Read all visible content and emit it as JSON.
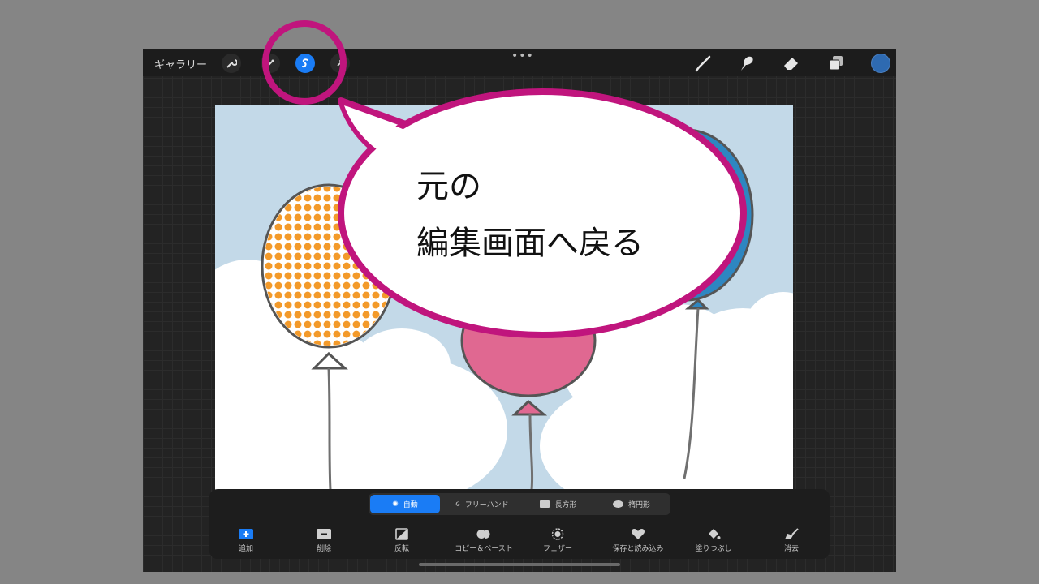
{
  "topbar": {
    "gallery_label": "ギャラリー",
    "more_label": "•••",
    "left_icons": [
      "wrench-icon",
      "magic-wand-icon",
      "selection-icon",
      "transform-arrow-icon"
    ],
    "right_icons": [
      "brush-icon",
      "smudge-icon",
      "eraser-icon",
      "layers-icon",
      "color-swatch-icon"
    ],
    "current_color": "#2e6ab1"
  },
  "callout": {
    "line1": "元の",
    "line2": "編集画面へ戻る",
    "color": "#c0157d"
  },
  "selection_modes": [
    {
      "label": "自動",
      "icon": "auto-icon",
      "active": true
    },
    {
      "label": "フリーハンド",
      "icon": "freehand-icon",
      "active": false
    },
    {
      "label": "長方形",
      "icon": "rectangle-icon",
      "active": false
    },
    {
      "label": "楕円形",
      "icon": "ellipse-icon",
      "active": false
    }
  ],
  "tools": [
    {
      "label": "追加",
      "icon": "add-icon"
    },
    {
      "label": "削除",
      "icon": "remove-icon"
    },
    {
      "label": "反転",
      "icon": "invert-icon"
    },
    {
      "label": "コピー＆ペースト",
      "icon": "copy-paste-icon"
    },
    {
      "label": "フェザー",
      "icon": "feather-icon"
    },
    {
      "label": "保存と読み込み",
      "icon": "heart-icon"
    },
    {
      "label": "塗りつぶし",
      "icon": "fill-icon"
    },
    {
      "label": "消去",
      "icon": "clear-icon"
    }
  ],
  "accent_color": "#1a7cf5"
}
